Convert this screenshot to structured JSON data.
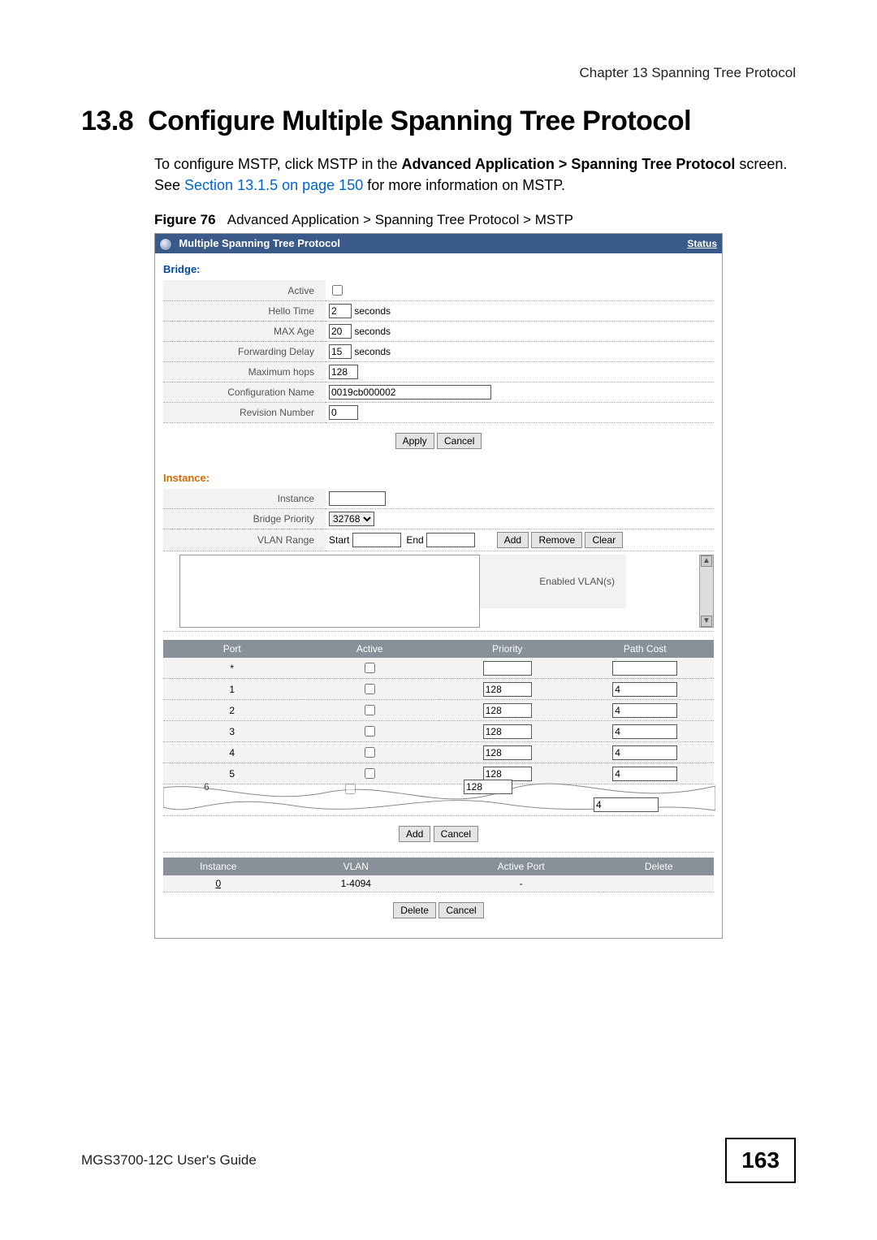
{
  "chapter_header": "Chapter 13 Spanning Tree Protocol",
  "section_number": "13.8",
  "section_title": "Configure Multiple Spanning Tree Protocol",
  "paragraph_pre": "To configure MSTP, click MSTP in the ",
  "paragraph_bold1": "Advanced Application > Spanning Tree Protocol",
  "paragraph_mid": " screen. See ",
  "paragraph_link": "Section 13.1.5 on page 150",
  "paragraph_post": " for more information on MSTP.",
  "figure_label": "Figure 76",
  "figure_caption": "Advanced Application > Spanning Tree Protocol > MSTP",
  "titlebar": {
    "title": "Multiple Spanning Tree Protocol",
    "status": "Status"
  },
  "bridge": {
    "heading": "Bridge:",
    "rows": {
      "active": "Active",
      "hello": "Hello Time",
      "hello_val": "2",
      "hello_suffix": "seconds",
      "maxage": "MAX Age",
      "maxage_val": "20",
      "maxage_suffix": "seconds",
      "fwd": "Forwarding Delay",
      "fwd_val": "15",
      "fwd_suffix": "seconds",
      "maxhops": "Maximum hops",
      "maxhops_val": "128",
      "confname": "Configuration Name",
      "confname_val": "0019cb000002",
      "rev": "Revision Number",
      "rev_val": "0"
    },
    "apply": "Apply",
    "cancel": "Cancel"
  },
  "instance": {
    "heading": "Instance:",
    "inst_label": "Instance",
    "bp_label": "Bridge Priority",
    "bp_val": "32768",
    "vr_label": "VLAN Range",
    "vr_start": "Start",
    "vr_end": "End",
    "vr_add": "Add",
    "vr_remove": "Remove",
    "vr_clear": "Clear",
    "ev_label": "Enabled VLAN(s)"
  },
  "porttable": {
    "headers": {
      "port": "Port",
      "active": "Active",
      "priority": "Priority",
      "pathcost": "Path Cost"
    },
    "rows": [
      {
        "port": "*",
        "priority": "",
        "pathcost": ""
      },
      {
        "port": "1",
        "priority": "128",
        "pathcost": "4"
      },
      {
        "port": "2",
        "priority": "128",
        "pathcost": "4"
      },
      {
        "port": "3",
        "priority": "128",
        "pathcost": "4"
      },
      {
        "port": "4",
        "priority": "128",
        "pathcost": "4"
      },
      {
        "port": "5",
        "priority": "128",
        "pathcost": "4"
      },
      {
        "port": "6",
        "priority": "128",
        "pathcost": ""
      }
    ],
    "extra_pathcost": "4",
    "add": "Add",
    "cancel": "Cancel"
  },
  "summary": {
    "headers": {
      "instance": "Instance",
      "vlan": "VLAN",
      "active": "Active Port",
      "delete": "Delete"
    },
    "row": {
      "instance": "0",
      "vlan": "1-4094",
      "active": "-",
      "delete": ""
    },
    "delete": "Delete",
    "cancel": "Cancel"
  },
  "footer_left": "MGS3700-12C User's Guide",
  "footer_right": "163"
}
